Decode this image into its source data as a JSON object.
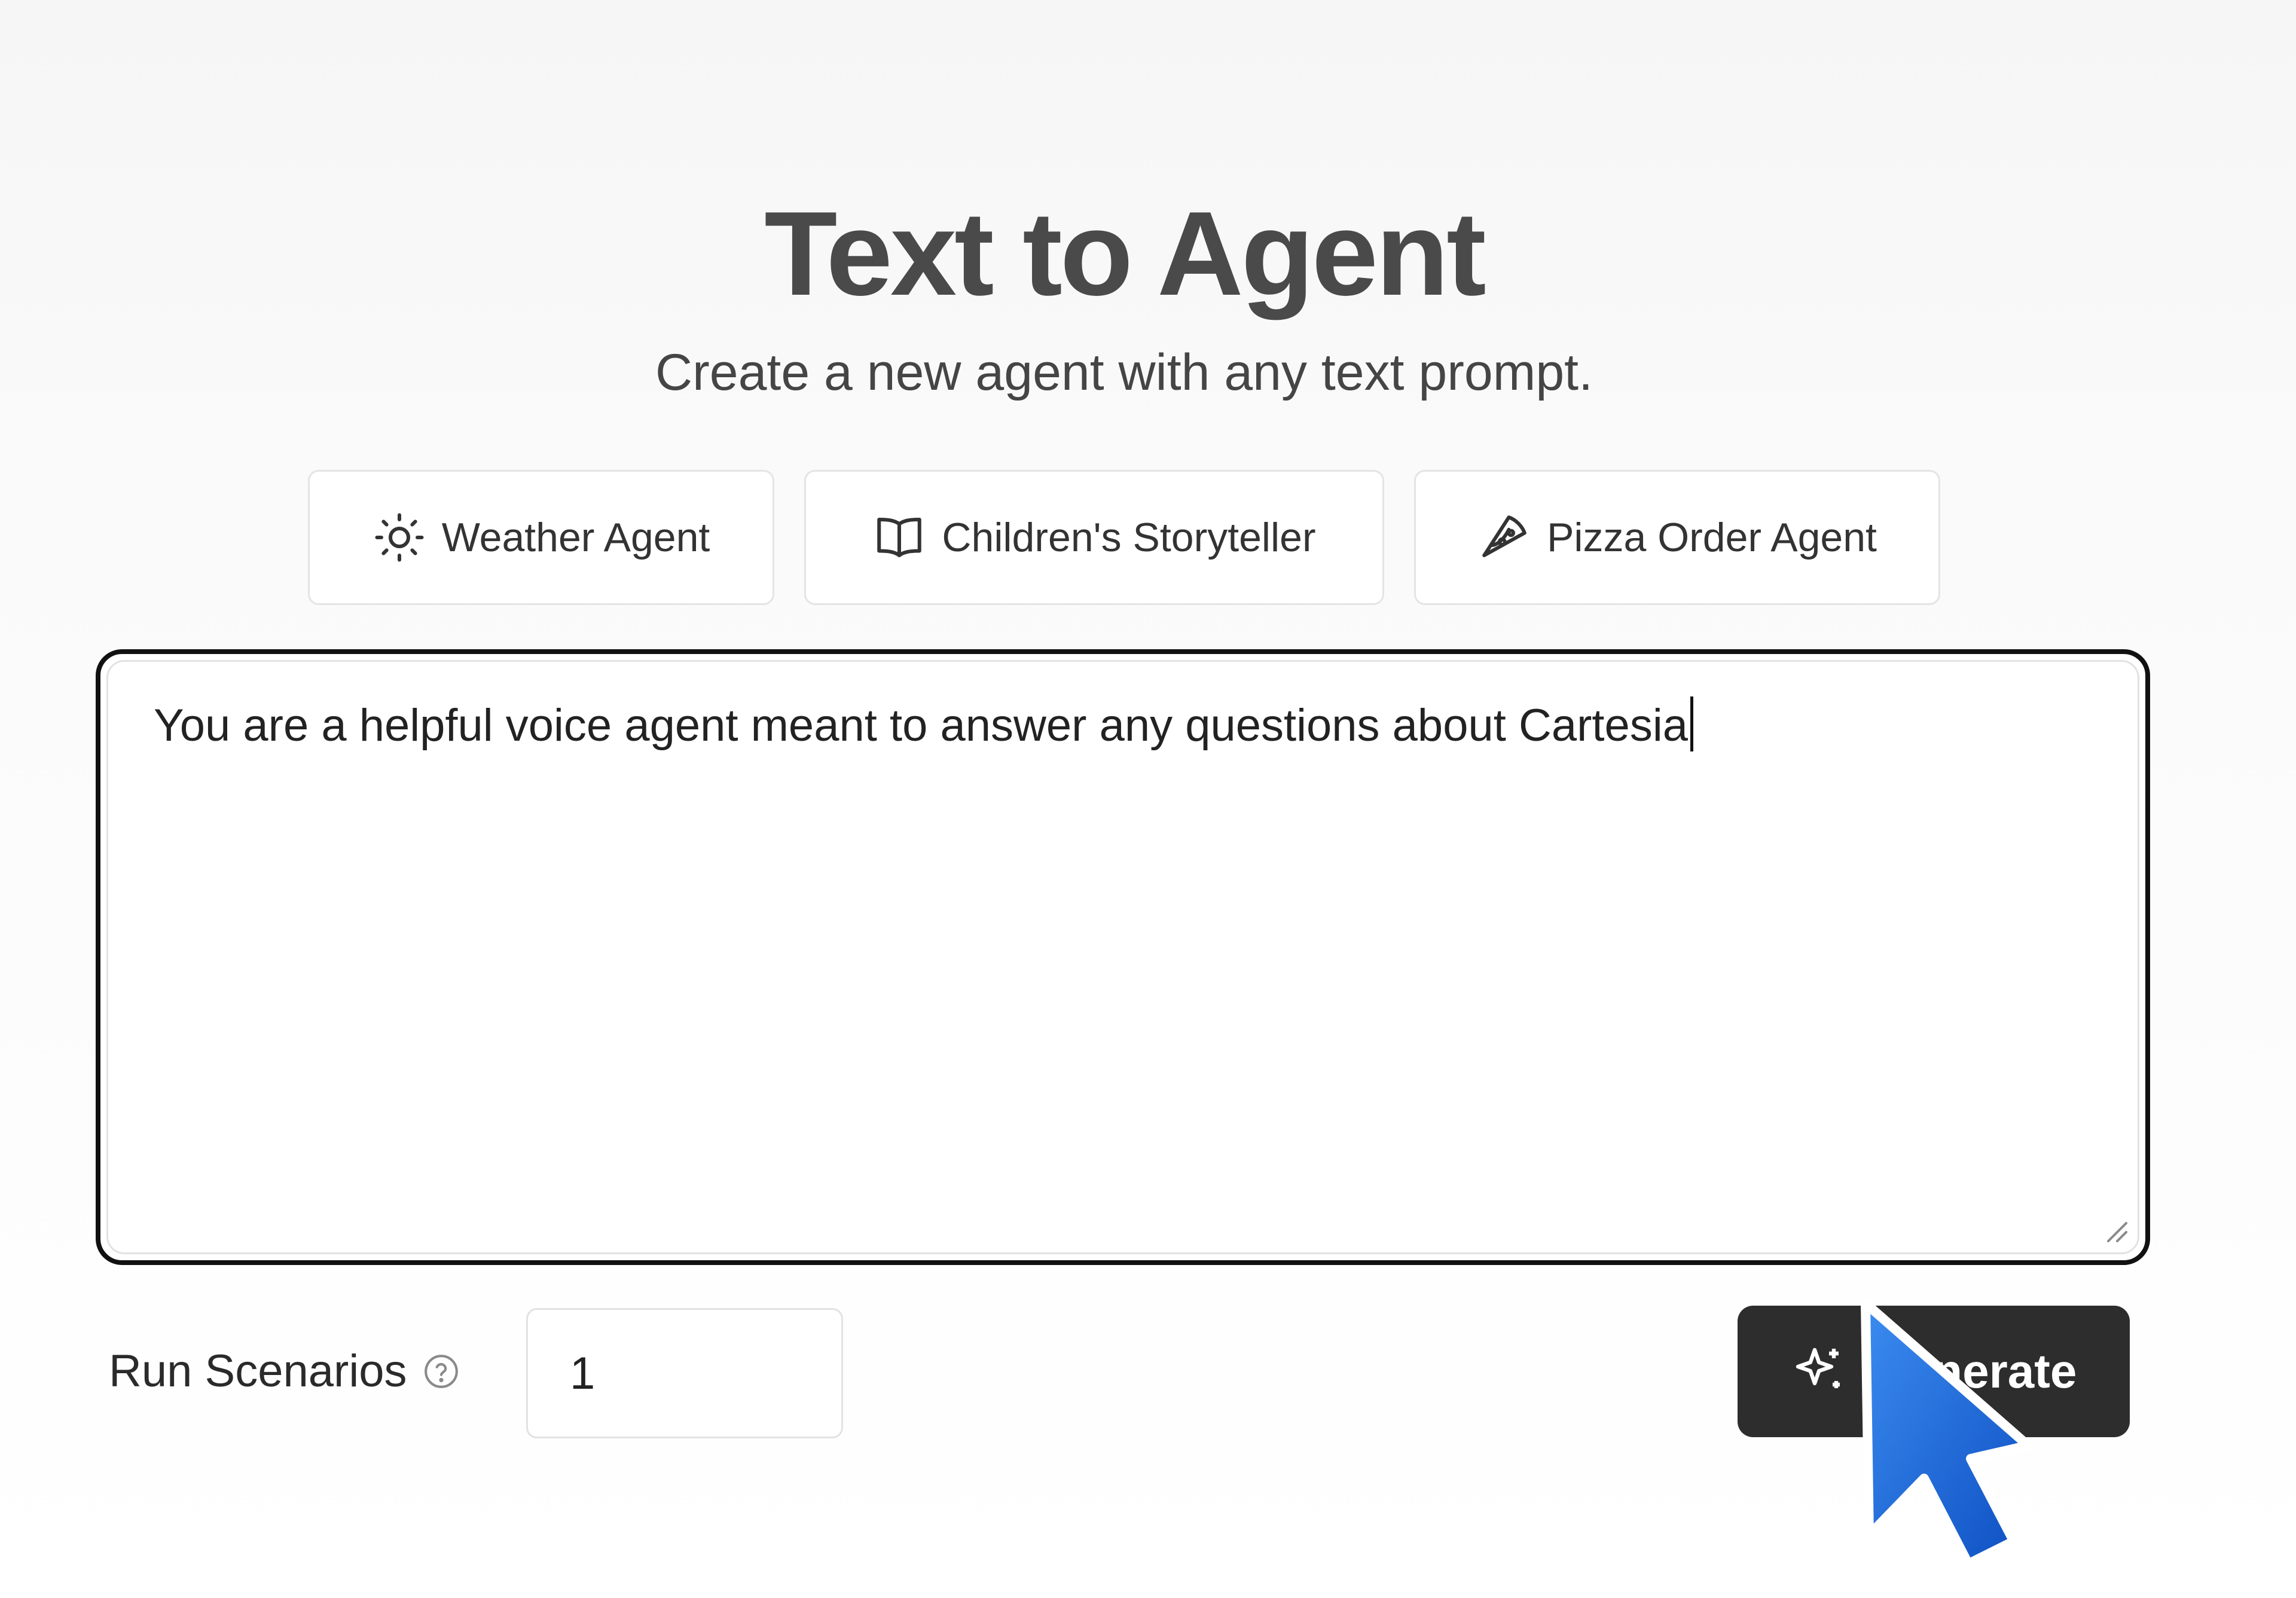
{
  "header": {
    "title": "Text to Agent",
    "subtitle": "Create a new agent with any text prompt."
  },
  "presets": [
    {
      "label": "Weather Agent",
      "icon": "sun-icon"
    },
    {
      "label": "Children's Storyteller",
      "icon": "book-icon"
    },
    {
      "label": "Pizza Order Agent",
      "icon": "pizza-icon"
    }
  ],
  "prompt": {
    "value": "You are a helpful voice agent meant to answer any questions about Cartesia"
  },
  "scenarios": {
    "label": "Run Scenarios",
    "value": "1"
  },
  "generate": {
    "label": "Generate",
    "icon": "sparkle-icon"
  },
  "colors": {
    "button_bg": "#2d2d2d",
    "cursor_blue": "#1565d8",
    "focus_border": "#111111"
  }
}
